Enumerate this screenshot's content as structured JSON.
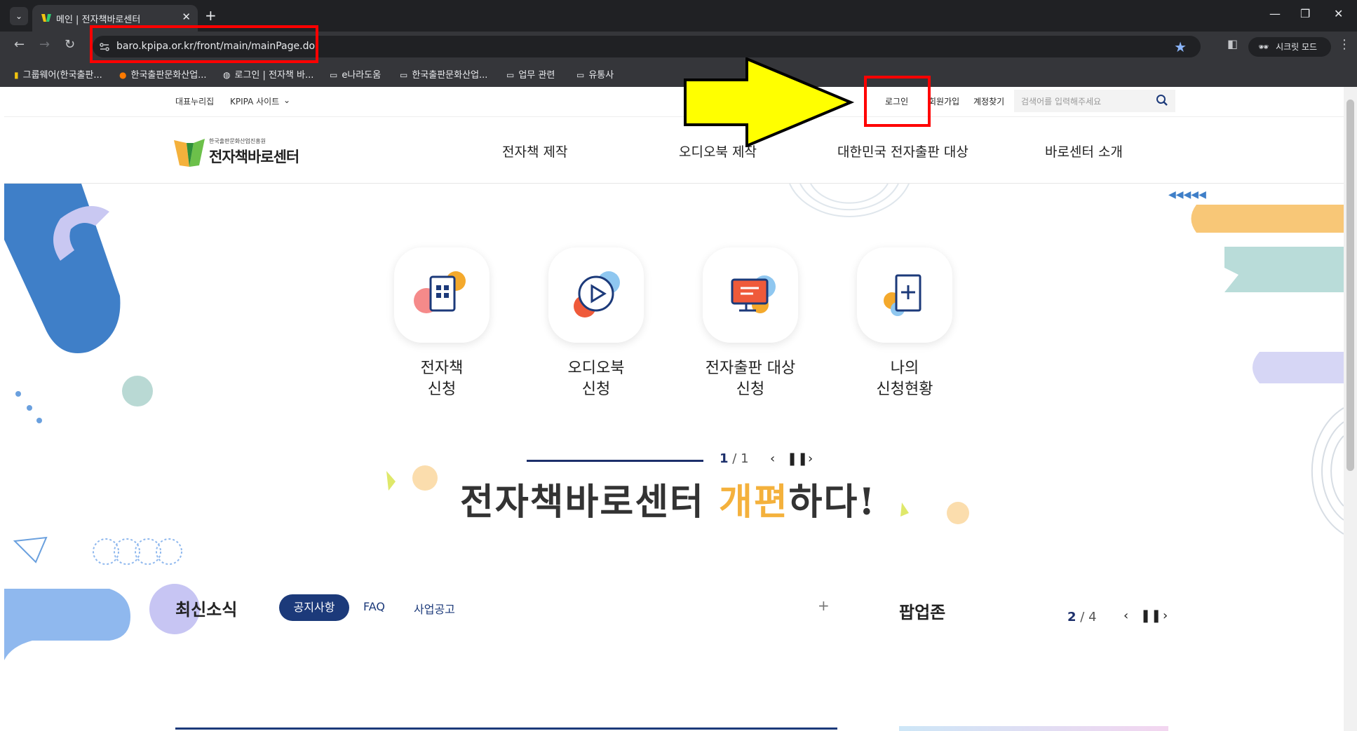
{
  "browser": {
    "tab_title": "메인 | 전자책바로센터",
    "tab_close": "✕",
    "new_tab": "+",
    "url": "baro.kpipa.or.kr/front/main/mainPage.do",
    "incognito_label": "시크릿 모드",
    "bookmarks": [
      {
        "label": "그룹웨어(한국출판...",
        "icon": "logo-icon"
      },
      {
        "label": "한국출판문화산업...",
        "icon": "h-icon"
      },
      {
        "label": "로그인 | 전자책 바...",
        "icon": "globe-icon"
      },
      {
        "label": "e나라도움",
        "icon": "folder-icon"
      },
      {
        "label": "한국출판문화산업...",
        "icon": "folder-icon"
      },
      {
        "label": "업무 관련",
        "icon": "folder-icon"
      },
      {
        "label": "유통사",
        "icon": "folder-icon"
      }
    ]
  },
  "utility": {
    "left": [
      "대표누리집",
      "KPIPA 사이트"
    ],
    "right": [
      "로그인",
      "회원가입",
      "계정찾기"
    ],
    "search_placeholder": "검색어를 입력해주세요"
  },
  "logo": {
    "small": "한국출판문화산업진흥원",
    "big": "전자책바로센터"
  },
  "gnb": [
    "전자책 제작",
    "오디오북 제작",
    "대한민국 전자출판 대상",
    "바로센터 소개"
  ],
  "services": [
    {
      "line1": "전자책",
      "line2": "신청",
      "icon": "ebook-icon"
    },
    {
      "line1": "오디오북",
      "line2": "신청",
      "icon": "audiobook-play-icon"
    },
    {
      "line1": "전자출판 대상",
      "line2": "신청",
      "icon": "monitor-icon"
    },
    {
      "line1": "나의",
      "line2": "신청현황",
      "icon": "document-plus-icon"
    }
  ],
  "banner": {
    "part1": "전자책바로센터 ",
    "accent": "개편",
    "part2": "하다!"
  },
  "slider": {
    "current": "1",
    "sep": "/",
    "total": "1"
  },
  "news": {
    "title": "최신소식",
    "tabs": [
      "공지사항",
      "FAQ",
      "사업공고"
    ],
    "more": "+"
  },
  "popup": {
    "title": "팝업존",
    "current": "2",
    "sep": "/",
    "total": "4"
  },
  "colors": {
    "navy": "#1c3a7a",
    "accent": "#f4b13c",
    "highlight": "#ff0000",
    "arrow": "#ffff00"
  }
}
